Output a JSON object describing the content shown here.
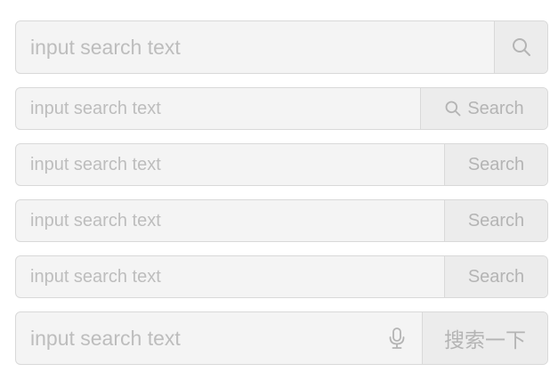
{
  "searches": [
    {
      "placeholder": "input search text",
      "button_icon": "search-icon"
    },
    {
      "placeholder": "input search text",
      "button_icon": "search-icon",
      "button_label": "Search"
    },
    {
      "placeholder": "input search text",
      "button_label": "Search"
    },
    {
      "placeholder": "input search text",
      "button_label": "Search"
    },
    {
      "placeholder": "input search text",
      "button_label": "Search"
    },
    {
      "placeholder": "input search text",
      "suffix_icon": "microphone-icon",
      "button_label": "搜索一下"
    }
  ],
  "colors": {
    "border": "#d9d9d9",
    "input_bg": "#f4f4f4",
    "button_bg": "#ececec",
    "placeholder": "#bdbdbd",
    "button_text": "#b4b4b4"
  }
}
